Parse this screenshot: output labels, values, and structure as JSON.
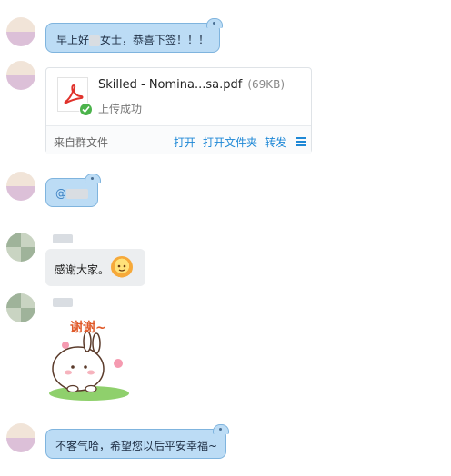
{
  "messages": {
    "m1": {
      "text_prefix": "早上好",
      "text_suffix": "女士，恭喜下签！！！"
    },
    "m2": {
      "file_name": "Skilled - Nomina...sa.pdf",
      "file_size": "(69KB)",
      "status": "上传成功",
      "source": "来自群文件",
      "actions": {
        "open": "打开",
        "open_folder": "打开文件夹",
        "forward": "转发"
      },
      "icon": "pdf-icon",
      "status_icon": "check-icon",
      "menu_icon": "menu-icon"
    },
    "m3": {
      "mention": "@"
    },
    "m4": {
      "text": "感谢大家。",
      "emoji": "sun-emoji"
    },
    "m5": {
      "sticker_text": "谢谢~",
      "sticker": "bunny-sticker"
    },
    "m6": {
      "text": "不客气哈，希望您以后平安幸福~"
    }
  },
  "colors": {
    "outgoing_bubble": "#bcdcf5",
    "outgoing_border": "#7fb4de",
    "incoming_bubble": "#eceef0",
    "link": "#1e88d6",
    "success": "#4bb34b",
    "pdf_red": "#e0322b"
  }
}
